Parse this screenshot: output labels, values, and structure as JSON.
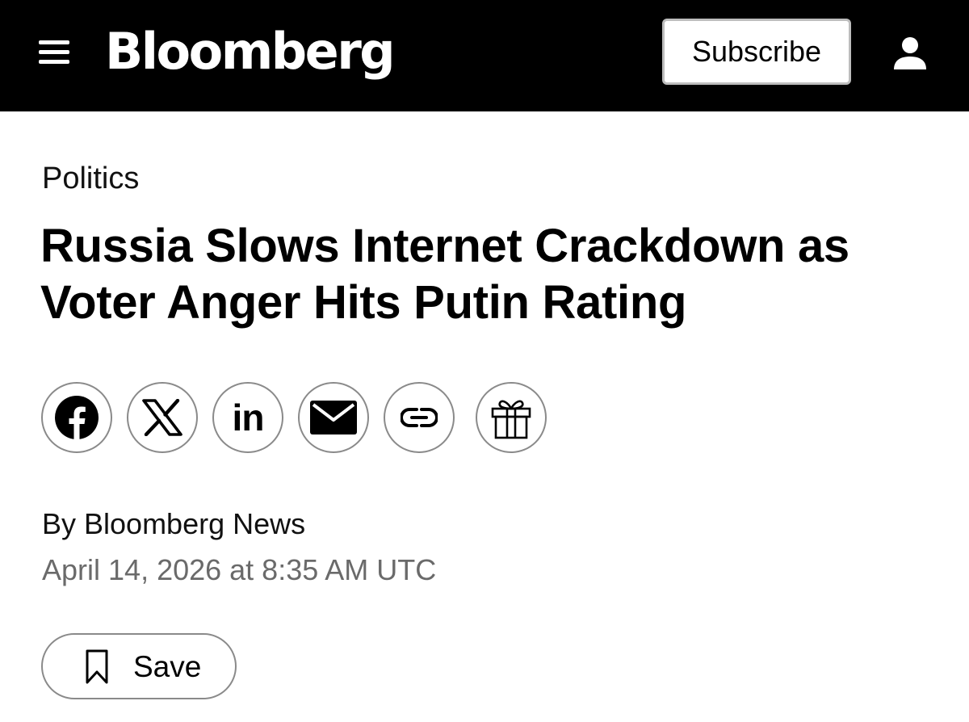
{
  "header": {
    "menu_icon": "hamburger-menu-icon",
    "logo_text": "Bloomberg",
    "subscribe_label": "Subscribe",
    "account_icon": "user-account-icon",
    "background_color": "#000000"
  },
  "article": {
    "section": "Politics",
    "headline": "Russia Slows Internet Crackdown as Voter Anger Hits Putin Rating",
    "share_buttons": [
      {
        "icon": "facebook-icon"
      },
      {
        "icon": "x-icon"
      },
      {
        "icon": "linkedin-icon",
        "glyph": "in"
      },
      {
        "icon": "email-icon"
      },
      {
        "icon": "copy-link-icon"
      },
      {
        "icon": "gift-icon"
      }
    ],
    "byline": "By Bloomberg News",
    "date": "April 14, 2026 at 8:35 AM UTC",
    "save_label": "Save",
    "save_icon": "bookmark-icon"
  }
}
